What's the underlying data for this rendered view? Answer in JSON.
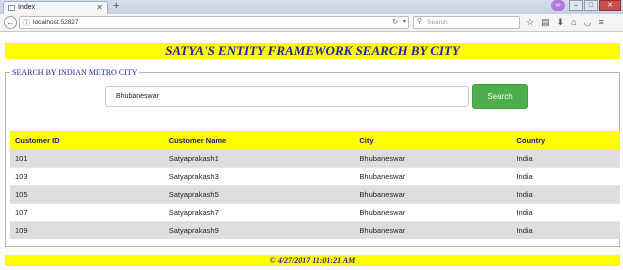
{
  "browser": {
    "tab_title": "Index",
    "tab_close": "✕",
    "new_tab": "+",
    "url": "localhost:52827",
    "search_placeholder": "Search"
  },
  "page": {
    "title": "SATYA'S ENTITY FRAMEWORK SEARCH BY CITY",
    "legend": "SEARCH BY INDIAN METRO CITY",
    "search_value": "Bhubaneswar",
    "search_button": "Search",
    "footer": "© 4/27/2017 11:01:21 AM"
  },
  "table": {
    "headers": [
      "Customer ID",
      "Customer Name",
      "City",
      "Country"
    ],
    "rows": [
      [
        "101",
        "Satyaprakash1",
        "Bhubaneswar",
        "India"
      ],
      [
        "103",
        "Satyaprakash3",
        "Bhubaneswar",
        "India"
      ],
      [
        "105",
        "Satyaprakash5",
        "Bhubaneswar",
        "India"
      ],
      [
        "107",
        "Satyaprakash7",
        "Bhubaneswar",
        "India"
      ],
      [
        "109",
        "Satyaprakash9",
        "Bhubaneswar",
        "India"
      ]
    ]
  },
  "colors": {
    "highlight": "#ffff00",
    "heading_text": "#2222aa",
    "button": "#4cae4c"
  }
}
